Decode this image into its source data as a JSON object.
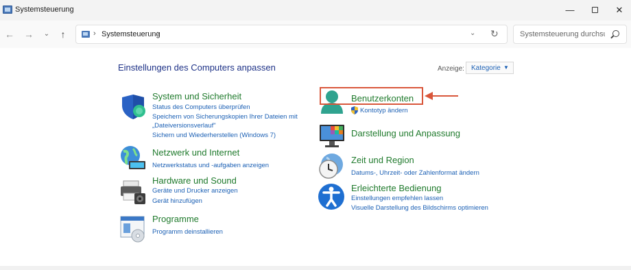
{
  "window": {
    "title": "Systemsteuerung",
    "minimize": "—",
    "close": "✕"
  },
  "nav": {
    "back": "←",
    "forward": "→",
    "recent": "⌄",
    "up": "↑",
    "address_sep": "›",
    "address_path": "Systemsteuerung",
    "address_dropdown": "⌄",
    "refresh": "↻",
    "search_placeholder": "Systemsteuerung durchsuc..."
  },
  "content": {
    "heading": "Einstellungen des Computers anpassen",
    "view_label": "Anzeige:",
    "view_value": "Kategorie",
    "view_caret": "▼"
  },
  "categories": {
    "system": {
      "title": "System und Sicherheit",
      "links": [
        "Status des Computers überprüfen",
        "Speichern von Sicherungskopien Ihrer Dateien mit",
        "„Dateiversionsverlauf\"",
        "Sichern und Wiederherstellen (Windows 7)"
      ]
    },
    "network": {
      "title": "Netzwerk und Internet",
      "links": [
        "Netzwerkstatus und -aufgaben anzeigen"
      ]
    },
    "hardware": {
      "title": "Hardware und Sound",
      "links": [
        "Geräte und Drucker anzeigen",
        "Gerät hinzufügen"
      ]
    },
    "programs": {
      "title": "Programme",
      "links": [
        "Programm deinstallieren"
      ]
    },
    "accounts": {
      "title": "Benutzerkonten",
      "links": [
        "Kontotyp ändern"
      ]
    },
    "appearance": {
      "title": "Darstellung und Anpassung",
      "links": []
    },
    "clock": {
      "title": "Zeit und Region",
      "links": [
        "Datums-, Uhrzeit- oder Zahlenformat ändern"
      ]
    },
    "ease": {
      "title": "Erleichterte Bedienung",
      "links": [
        "Einstellungen empfehlen lassen",
        "Visuelle Darstellung des Bildschirms optimieren"
      ]
    }
  },
  "colors": {
    "category_title": "#1f7a2c",
    "link": "#1a5fb4",
    "heading": "#1e3287",
    "annotation": "#d9563a"
  }
}
